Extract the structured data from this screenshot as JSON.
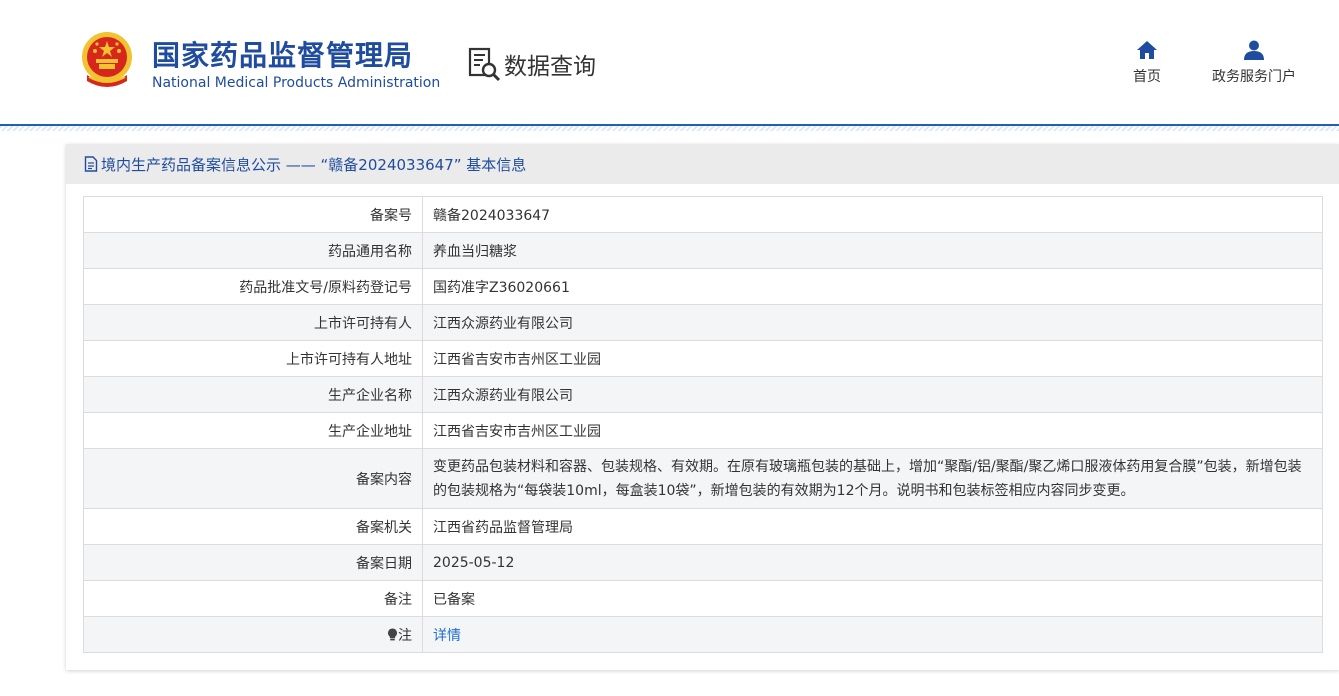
{
  "header": {
    "title_cn": "国家药品监督管理局",
    "title_en": "National Medical Products Administration",
    "section_title": "数据查询",
    "nav": [
      {
        "label": "首页",
        "icon": "home-icon"
      },
      {
        "label": "政务服务门户",
        "icon": "user-icon"
      }
    ]
  },
  "panel": {
    "heading": "境内生产药品备案信息公示 —— “赣备2024033647” 基本信息"
  },
  "rows": [
    {
      "key": "备案号",
      "value": "赣备2024033647"
    },
    {
      "key": "药品通用名称",
      "value": "养血当归糖浆"
    },
    {
      "key": "药品批准文号/原料药登记号",
      "value": "国药准字Z36020661"
    },
    {
      "key": "上市许可持有人",
      "value": "江西众源药业有限公司"
    },
    {
      "key": "上市许可持有人地址",
      "value": "江西省吉安市吉州区工业园"
    },
    {
      "key": "生产企业名称",
      "value": "江西众源药业有限公司"
    },
    {
      "key": "生产企业地址",
      "value": "江西省吉安市吉州区工业园"
    },
    {
      "key": "备案内容",
      "value": "变更药品包装材料和容器、包装规格、有效期。在原有玻璃瓶包装的基础上，增加“聚酯/铝/聚酯/聚乙烯口服液体药用复合膜”包装，新增包装的包装规格为“每袋装10ml，每盒装10袋”，新增包装的有效期为12个月。说明书和包装标签相应内容同步变更。"
    },
    {
      "key": "备案机关",
      "value": "江西省药品监督管理局"
    },
    {
      "key": "备案日期",
      "value": "2025-05-12"
    },
    {
      "key": "备注",
      "value": "已备案"
    },
    {
      "key": "注",
      "value": "详情"
    }
  ],
  "colors": {
    "brand_blue": "#1f4c9e",
    "link_blue": "#1f6fcf",
    "emblem_red": "#d7261c",
    "emblem_gold": "#f2c230"
  }
}
